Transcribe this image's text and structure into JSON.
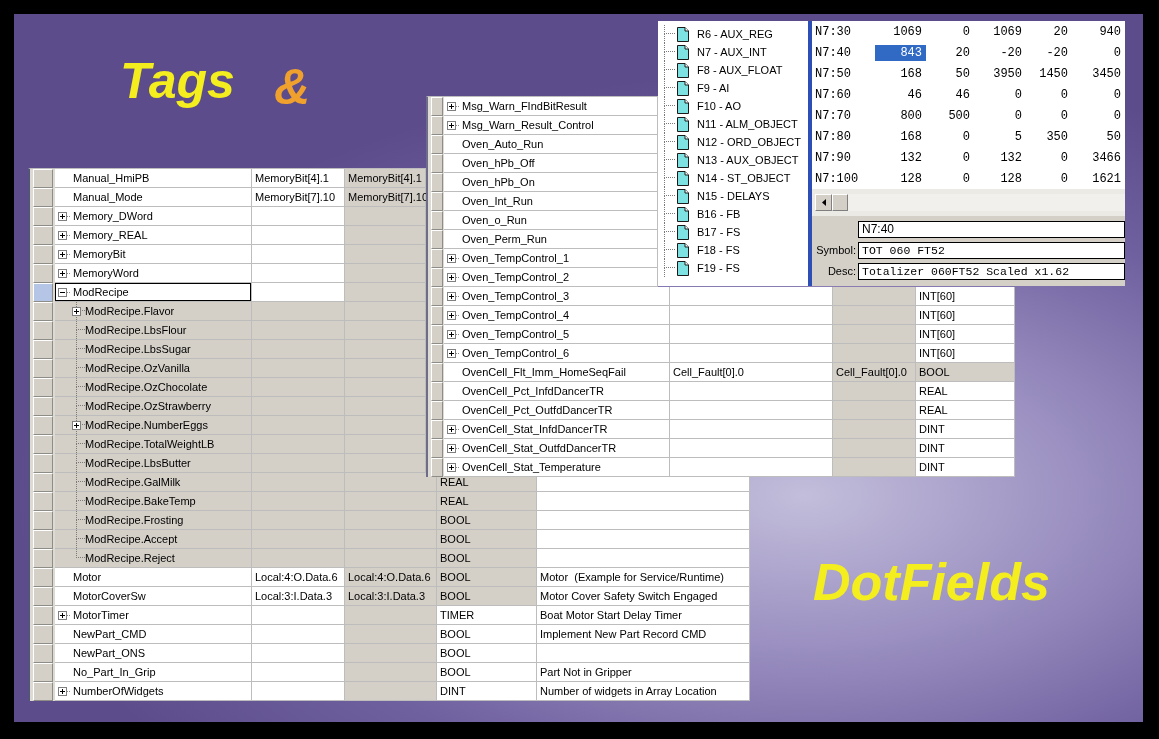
{
  "heading_top": [
    {
      "text": "Tags",
      "color": "#f4ee1e"
    },
    {
      "text": "&",
      "color": "#f0a02c"
    }
  ],
  "heading_bottom": {
    "text": "DotFields"
  },
  "tag_table_left": {
    "rows": [
      {
        "name": "Manual_HmiPB",
        "selected": false,
        "column_2": "MemoryBit[4].1",
        "column_3": "MemoryBit[4].1"
      },
      {
        "name": "Manual_Mode",
        "selected": false,
        "column_2": "MemoryBit[7].10",
        "column_3": "MemoryBit[7].10"
      },
      {
        "name": "Memory_DWord",
        "selected": false,
        "expanded": false
      },
      {
        "name": "Memory_REAL",
        "selected": false,
        "expanded": false
      },
      {
        "name": "MemoryBit",
        "selected": false,
        "expanded": false
      },
      {
        "name": "MemoryWord",
        "selected": false,
        "expanded": false
      },
      {
        "name": "ModRecipe",
        "selected": true,
        "expanded": true,
        "children": [
          {
            "name": "ModRecipe.Flavor",
            "selected": false,
            "expanded": false
          },
          {
            "name": "ModRecipe.LbsFlour",
            "selected": false
          },
          {
            "name": "ModRecipe.LbsSugar",
            "selected": false
          },
          {
            "name": "ModRecipe.OzVanilla",
            "selected": false
          },
          {
            "name": "ModRecipe.OzChocolate",
            "selected": false
          },
          {
            "name": "ModRecipe.OzStrawberry",
            "selected": false
          },
          {
            "name": "ModRecipe.NumberEggs",
            "selected": false,
            "expanded": false
          },
          {
            "name": "ModRecipe.TotalWeightLB",
            "selected": false
          },
          {
            "name": "ModRecipe.LbsButter",
            "selected": false
          },
          {
            "name": "ModRecipe.GalMilk",
            "selected": false,
            "column_4": "REAL"
          },
          {
            "name": "ModRecipe.BakeTemp",
            "selected": false,
            "column_4": "REAL"
          },
          {
            "name": "ModRecipe.Frosting",
            "selected": false,
            "column_4": "BOOL"
          },
          {
            "name": "ModRecipe.Accept",
            "selected": false,
            "column_4": "BOOL"
          },
          {
            "name": "ModRecipe.Reject",
            "selected": false,
            "column_4": "BOOL"
          }
        ]
      },
      {
        "name": "Motor",
        "selected": false,
        "column_2": "Local:4:O.Data.6",
        "column_3": "Local:4:O.Data.6",
        "column_4": "BOOL",
        "column_5": "Motor  (Example for Service/Runtime)"
      },
      {
        "name": "MotorCoverSw",
        "selected": false,
        "column_2": "Local:3:I.Data.3",
        "column_3": "Local:3:I.Data.3",
        "column_4": "BOOL",
        "column_5": "Motor Cover Safety Switch Engaged"
      },
      {
        "name": "MotorTimer",
        "selected": false,
        "expanded": false,
        "column_4": "TIMER",
        "column_5": "Boat Motor Start Delay Timer"
      },
      {
        "name": "NewPart_CMD",
        "selected": false,
        "column_4": "BOOL",
        "column_5": "Implement New Part Record CMD"
      },
      {
        "name": "NewPart_ONS",
        "selected": false,
        "column_4": "BOOL"
      },
      {
        "name": "No_Part_In_Grip",
        "selected": false,
        "column_4": "BOOL",
        "column_5": "Part Not in Gripper"
      },
      {
        "name": "NumberOfWidgets",
        "selected": false,
        "expanded": false,
        "column_4": "DINT",
        "column_5": "Number of widgets in Array Location"
      }
    ]
  },
  "tag_table_middle": {
    "rows": [
      {
        "name": "Msg_Warn_FIndBitResult",
        "selected": false,
        "expanded": false
      },
      {
        "name": "Msg_Warn_Result_Control",
        "selected": false,
        "expanded": false
      },
      {
        "name": "Oven_Auto_Run",
        "selected": false
      },
      {
        "name": "Oven_hPb_Off",
        "selected": false
      },
      {
        "name": "Oven_hPb_On",
        "selected": false
      },
      {
        "name": "Oven_Int_Run",
        "selected": false
      },
      {
        "name": "Oven_o_Run",
        "selected": false
      },
      {
        "name": "Oven_Perm_Run",
        "selected": false
      },
      {
        "name": "Oven_TempControl_1",
        "selected": false,
        "expanded": false
      },
      {
        "name": "Oven_TempControl_2",
        "selected": false,
        "expanded": false
      },
      {
        "name": "Oven_TempControl_3",
        "selected": false,
        "expanded": false,
        "column_4": "INT[60]"
      },
      {
        "name": "Oven_TempControl_4",
        "selected": false,
        "expanded": false,
        "column_4": "INT[60]"
      },
      {
        "name": "Oven_TempControl_5",
        "selected": false,
        "expanded": false,
        "column_4": "INT[60]"
      },
      {
        "name": "Oven_TempControl_6",
        "selected": false,
        "expanded": false,
        "column_4": "INT[60]"
      },
      {
        "name": "OvenCell_Flt_Imm_HomeSeqFail",
        "selected": false,
        "column_2": "Cell_Fault[0].0",
        "column_3": "Cell_Fault[0].0",
        "column_4": "BOOL"
      },
      {
        "name": "OvenCell_Pct_InfdDancerTR",
        "selected": false,
        "column_4": "REAL"
      },
      {
        "name": "OvenCell_Pct_OutfdDancerTR",
        "selected": false,
        "column_4": "REAL"
      },
      {
        "name": "OvenCell_Stat_InfdDancerTR",
        "selected": false,
        "expanded": false,
        "column_4": "DINT"
      },
      {
        "name": "OvenCell_Stat_OutfdDancerTR",
        "selected": false,
        "expanded": false,
        "column_4": "DINT"
      },
      {
        "name": "OvenCell_Stat_Temperature",
        "selected": false,
        "expanded": false,
        "column_4": "DINT"
      }
    ]
  },
  "data_file_window": {
    "files": [
      "R6 - AUX_REG",
      "N7 - AUX_INT",
      "F8 - AUX_FLOAT",
      "F9 - AI",
      "F10 - AO",
      "N11 - ALM_OBJECT",
      "N12 - ORD_OBJECT",
      "N13 - AUX_OBJECT",
      "N14 - ST_OBJECT",
      "N15 - DELAYS",
      "B16 - FB",
      "B17 - FS",
      "F18 - FS",
      "F19 - FS"
    ],
    "rows": [
      {
        "address": "N7:30",
        "values": [
          {
            "text": "1069",
            "selected": false
          },
          {
            "text": "0",
            "selected": false
          },
          {
            "text": "1069",
            "selected": false
          },
          {
            "text": "20",
            "selected": false
          },
          {
            "text": "940",
            "selected": false
          }
        ]
      },
      {
        "address": "N7:40",
        "values": [
          {
            "text": "843",
            "selected": true
          },
          {
            "text": "20",
            "selected": false
          },
          {
            "text": "-20",
            "selected": false
          },
          {
            "text": "-20",
            "selected": false
          },
          {
            "text": "0",
            "selected": false
          }
        ]
      },
      {
        "address": "N7:50",
        "values": [
          {
            "text": "168",
            "selected": false
          },
          {
            "text": "50",
            "selected": false
          },
          {
            "text": "3950",
            "selected": false
          },
          {
            "text": "1450",
            "selected": false
          },
          {
            "text": "3450",
            "selected": false
          }
        ]
      },
      {
        "address": "N7:60",
        "values": [
          {
            "text": "46",
            "selected": false
          },
          {
            "text": "46",
            "selected": false
          },
          {
            "text": "0",
            "selected": false
          },
          {
            "text": "0",
            "selected": false
          },
          {
            "text": "0",
            "selected": false
          }
        ]
      },
      {
        "address": "N7:70",
        "values": [
          {
            "text": "800",
            "selected": false
          },
          {
            "text": "500",
            "selected": false
          },
          {
            "text": "0",
            "selected": false
          },
          {
            "text": "0",
            "selected": false
          },
          {
            "text": "0",
            "selected": false
          }
        ]
      },
      {
        "address": "N7:80",
        "values": [
          {
            "text": "168",
            "selected": false
          },
          {
            "text": "0",
            "selected": false
          },
          {
            "text": "5",
            "selected": false
          },
          {
            "text": "350",
            "selected": false
          },
          {
            "text": "50",
            "selected": false
          }
        ]
      },
      {
        "address": "N7:90",
        "values": [
          {
            "text": "132",
            "selected": false
          },
          {
            "text": "0",
            "selected": false
          },
          {
            "text": "132",
            "selected": false
          },
          {
            "text": "0",
            "selected": false
          },
          {
            "text": "3466",
            "selected": false
          }
        ]
      },
      {
        "address": "N7:100",
        "values": [
          {
            "text": "128",
            "selected": false
          },
          {
            "text": "0",
            "selected": false
          },
          {
            "text": "128",
            "selected": false
          },
          {
            "text": "0",
            "selected": false
          },
          {
            "text": "1621",
            "selected": false
          }
        ]
      }
    ],
    "address_field": {
      "value": "N7:40"
    },
    "symbol_field": {
      "label": "Symbol:",
      "value": "TOT 060 FT52"
    },
    "desc_field": {
      "label": "Desc:",
      "value": "Totalizer 060FT52 Scaled x1.62"
    }
  }
}
